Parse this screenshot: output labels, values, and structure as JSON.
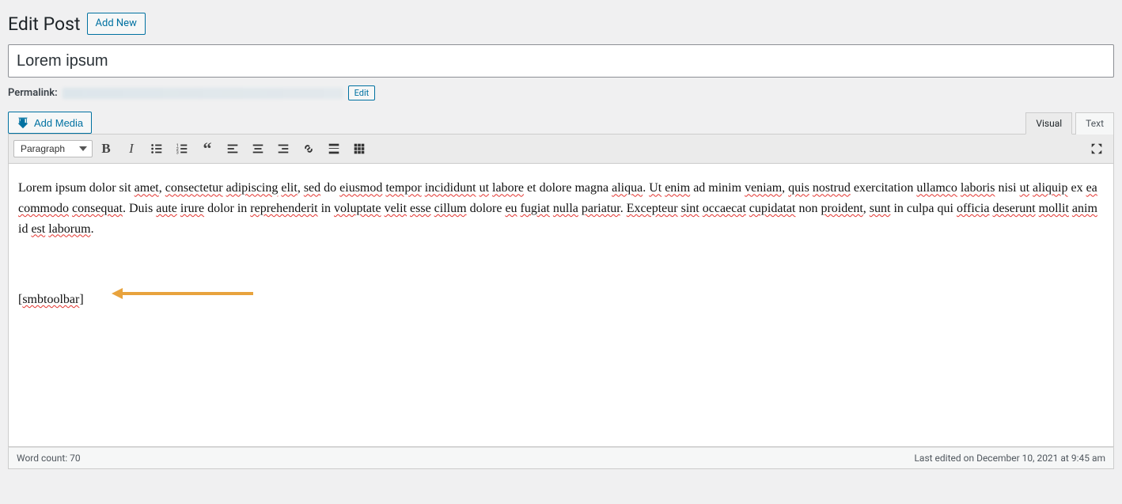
{
  "header": {
    "title": "Edit Post",
    "add_new": "Add New"
  },
  "post": {
    "title_value": "Lorem ipsum"
  },
  "permalink": {
    "label": "Permalink:",
    "edit": "Edit"
  },
  "media": {
    "add_media": "Add Media"
  },
  "editor_tabs": {
    "visual": "Visual",
    "text": "Text"
  },
  "format": {
    "selected": "Paragraph"
  },
  "content": {
    "paragraph_html": "Lorem ipsum dolor sit <span class='spell'>amet</span>, <span class='spell'>consectetur</span> <span class='spell'>adipiscing</span> <span class='spell'>elit</span>, <span class='spell'>sed</span> do <span class='spell'>eiusmod</span> <span class='spell'>tempor</span> <span class='spell'>incididunt</span> <span class='spell'>ut</span> <span class='spell'>labore</span> et dolore magna <span class='spell'>aliqua</span>. <span class='spell'>Ut</span> <span class='spell'>enim</span> ad minim <span class='spell'>veniam</span>, <span class='spell'>quis</span> <span class='spell'>nostrud</span> exercitation <span class='spell'>ullamco</span> <span class='spell'>laboris</span> nisi <span class='spell'>ut</span> <span class='spell'>aliquip</span> ex <span class='spell'>ea</span> <span class='spell'>commodo</span> <span class='spell'>consequat</span>. Duis <span class='spell'>aute</span> <span class='spell'>irure</span> dolor in <span class='spell'>reprehenderit</span> in <span class='spell'>voluptate</span> <span class='spell'>velit</span> <span class='spell'>esse</span> <span class='spell'>cillum</span> dolore <span class='spell'>eu</span> <span class='spell'>fugiat</span> <span class='spell'>nulla</span> <span class='spell'>pariatur</span>. <span class='spell'>Excepteur</span> <span class='spell'>sint</span> <span class='spell'>occaecat</span> <span class='spell'>cupidatat</span> non <span class='spell'>proident</span>, <span class='spell'>sunt</span> in culpa qui <span class='spell'>officia</span> <span class='spell'>deserunt</span> <span class='spell'>mollit</span> <span class='spell'>anim</span> id <span class='spell'>est</span> <span class='spell'>laborum</span>.",
    "shortcode_html": "[<span class='spell'>smbtoolbar</span>]"
  },
  "status": {
    "word_count": "Word count: 70",
    "last_edited": "Last edited on December 10, 2021 at 9:45 am"
  }
}
